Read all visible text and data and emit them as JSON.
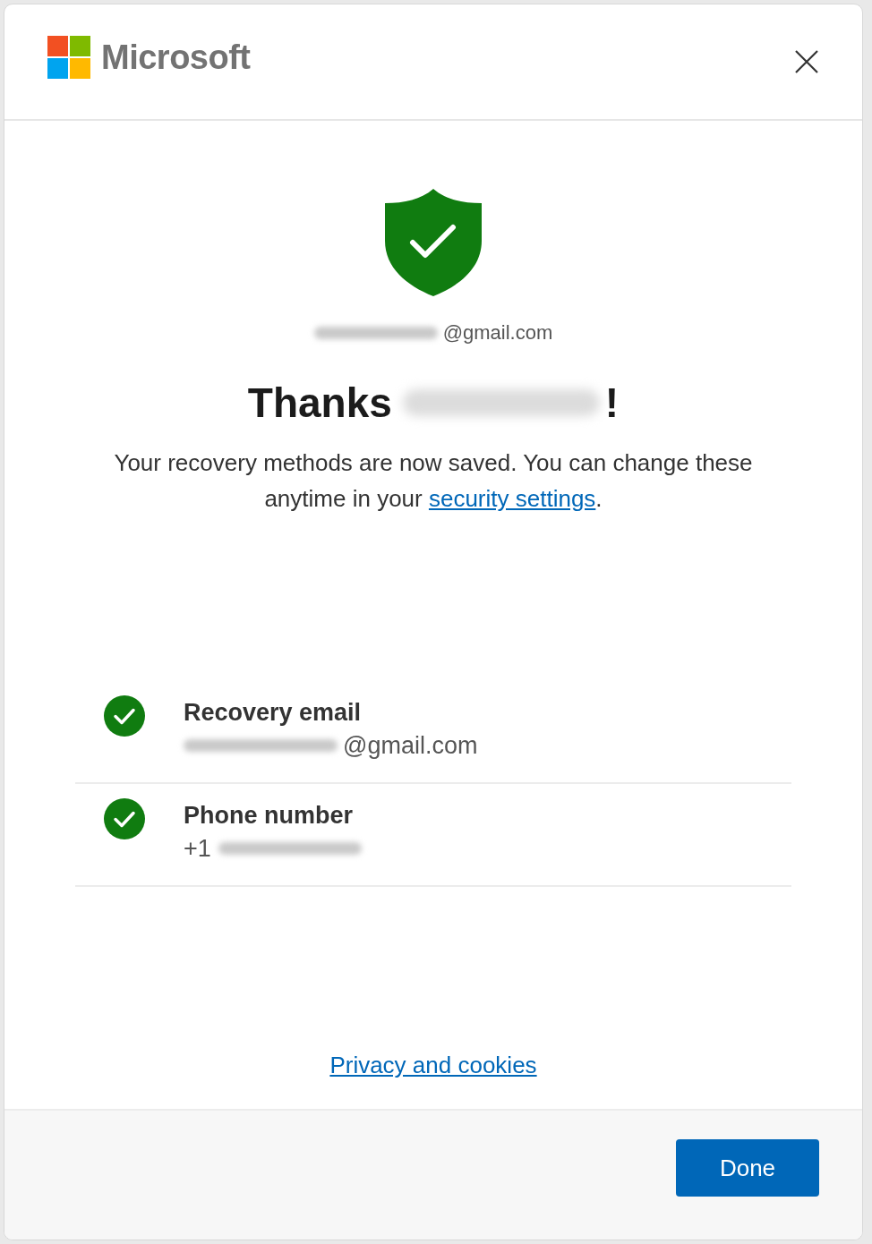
{
  "header": {
    "logo_text": "Microsoft"
  },
  "account": {
    "email_suffix": "@gmail.com"
  },
  "heading": {
    "greeting": "Thanks",
    "end": "!"
  },
  "message": {
    "before": "Your recovery methods are now saved. You can change these anytime in your ",
    "link": "security settings",
    "after": "."
  },
  "methods": [
    {
      "label": "Recovery email",
      "value": "@gmail.com",
      "kind": "email",
      "verified": true
    },
    {
      "label": "Phone number",
      "value": "+1",
      "kind": "phone",
      "verified": true
    }
  ],
  "footer_link": "Privacy and cookies",
  "buttons": [
    "Done"
  ]
}
